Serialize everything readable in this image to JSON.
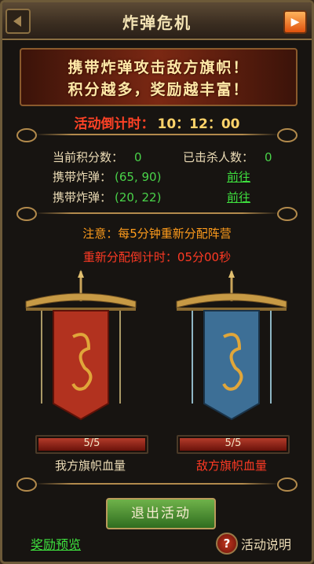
{
  "header": {
    "title": "炸弹危机"
  },
  "banner": {
    "line1": "携带炸弹攻击敌方旗帜！",
    "line2": "积分越多，奖励越丰富！"
  },
  "countdown": {
    "label": "活动倒计时：",
    "value": "10：12：00"
  },
  "stats": {
    "score_label": "当前积分数：",
    "score_value": "0",
    "kills_label": "已击杀人数：",
    "kills_value": "0",
    "bomb1_label": "携带炸弹：",
    "bomb1_coord": "(65, 90)",
    "bomb1_link": "前往",
    "bomb2_label": "携带炸弹：",
    "bomb2_coord": "(20, 22)",
    "bomb2_link": "前往"
  },
  "notice": {
    "rule": "注意：每5分钟重新分配阵营",
    "reassign_label": "重新分配倒计时：",
    "reassign_value": "05分00秒"
  },
  "flags": [
    {
      "hp_text": "5/5",
      "hp_fraction": 1.0,
      "label": "我方旗帜血量",
      "color": "#ecdcb6",
      "cloth": "#b2321f"
    },
    {
      "hp_text": "5/5",
      "hp_fraction": 1.0,
      "label": "敌方旗帜血量",
      "color": "#ff3a24",
      "cloth": "#3d6f96"
    }
  ],
  "footer": {
    "exit_label": "退出活动",
    "preview_label": "奖励预览",
    "help_label": "活动说明",
    "help_glyph": "?"
  }
}
